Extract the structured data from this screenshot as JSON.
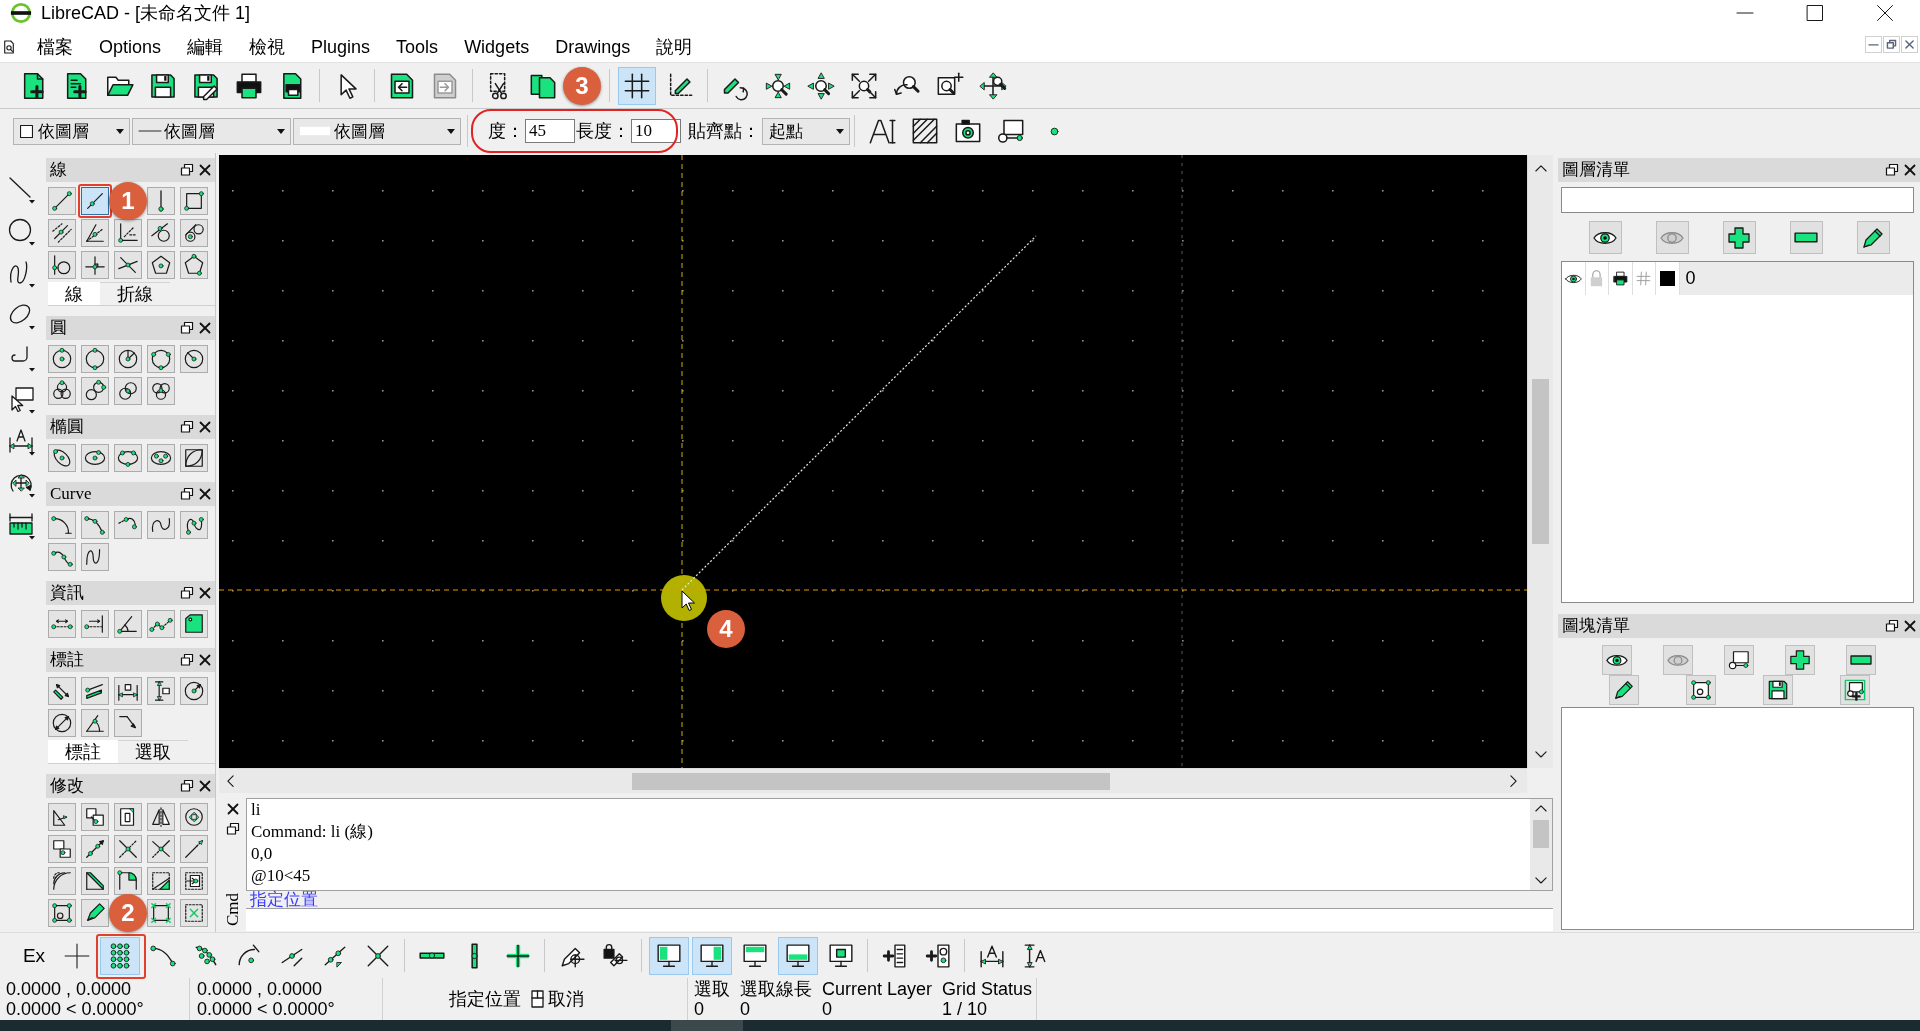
{
  "window": {
    "title": "LibreCAD - [未命名文件 1]"
  },
  "menu_bar": {
    "items": [
      "檔案",
      "Options",
      "編輯",
      "檢視",
      "Plugins",
      "Tools",
      "Widgets",
      "Drawings",
      "說明"
    ]
  },
  "main_toolbar": {
    "groups": [
      {
        "buttons": [
          {
            "kind": "new"
          },
          {
            "kind": "template"
          },
          {
            "kind": "open"
          },
          {
            "kind": "save"
          },
          {
            "kind": "saveas"
          },
          {
            "kind": "print"
          },
          {
            "kind": "preview"
          }
        ]
      },
      {
        "buttons": [
          {
            "kind": "select"
          }
        ]
      },
      {
        "buttons": [
          {
            "kind": "undo"
          },
          {
            "kind": "redo"
          }
        ]
      },
      {
        "buttons": [
          {
            "kind": "cut"
          },
          {
            "kind": "copy"
          },
          {
            "kind": "callout",
            "label": "3"
          }
        ]
      },
      {
        "buttons": [
          {
            "kind": "grid",
            "selected": true
          },
          {
            "kind": "draft",
            "selected": false
          }
        ]
      },
      {
        "buttons": [
          {
            "kind": "redraw"
          },
          {
            "kind": "zoomin"
          },
          {
            "kind": "zoomout"
          },
          {
            "kind": "zoomauto"
          },
          {
            "kind": "zoomprev"
          },
          {
            "kind": "zoomwin"
          },
          {
            "kind": "zoompan"
          }
        ]
      }
    ]
  },
  "property_bar": {
    "combos": [
      {
        "kind": "color",
        "value": "依圖層"
      },
      {
        "kind": "linetype",
        "value": "依圖層"
      },
      {
        "kind": "width",
        "value": "依圖層"
      }
    ]
  },
  "line_options": {
    "angle_label": "度：",
    "angle": "45",
    "length_label": "長度：",
    "length": "10",
    "snap_label": "貼齊點：",
    "snap_point": "起點"
  },
  "insert_toolbar": {
    "buttons": [
      {
        "kind": "text"
      },
      {
        "kind": "hatch"
      },
      {
        "kind": "image"
      },
      {
        "kind": "block"
      },
      {
        "kind": "point"
      }
    ]
  },
  "tool_strip": {
    "buttons": [
      {
        "kind": "tline"
      },
      {
        "kind": "tcircle"
      },
      {
        "kind": "tspline"
      },
      {
        "kind": "tellipse"
      },
      {
        "kind": "tpolyline"
      },
      {
        "kind": "tselect"
      },
      {
        "kind": "tdim"
      },
      {
        "kind": "tmodify"
      },
      {
        "kind": "tinfo"
      }
    ]
  },
  "toolbox": [
    {
      "title": "線",
      "buttons": [
        {
          "kind": "line2p",
          "selected": false
        },
        {
          "kind": "lineangle",
          "selected": true
        },
        {
          "kind": "callout",
          "label": "1"
        },
        {
          "kind": "linever",
          "selected": false
        },
        {
          "kind": "rect",
          "selected": false
        },
        {
          "kind": "parallel",
          "selected": false
        },
        {
          "kind": "bisector",
          "selected": false
        },
        {
          "kind": "axes",
          "selected": false
        },
        {
          "kind": "tangent",
          "selected": false
        },
        {
          "kind": "tancircles",
          "selected": false
        },
        {
          "kind": "circleline",
          "selected": false
        },
        {
          "kind": "perpendicular",
          "selected": false
        },
        {
          "kind": "crossing",
          "selected": false
        },
        {
          "kind": "polycenter",
          "selected": false
        },
        {
          "kind": "polycorner",
          "selected": false
        }
      ],
      "tabs": [
        {
          "label": "線",
          "selected": true
        },
        {
          "label": "折線",
          "selected": false
        }
      ]
    },
    {
      "title": "圓",
      "buttons": [
        {
          "kind": "circcenter"
        },
        {
          "kind": "circ2p"
        },
        {
          "kind": "circsector"
        },
        {
          "kind": "circ3p"
        },
        {
          "kind": "circradius"
        },
        {
          "kind": "circles"
        },
        {
          "kind": "twocircles"
        },
        {
          "kind": "overlapcircles"
        },
        {
          "kind": "circlecluster"
        }
      ]
    },
    {
      "title": "橢圓",
      "buttons": [
        {
          "kind": "ellipse"
        },
        {
          "kind": "ellcenter"
        },
        {
          "kind": "ellpoints"
        },
        {
          "kind": "ellfoci"
        },
        {
          "kind": "ellinscribed"
        }
      ]
    },
    {
      "title": "Curve",
      "buttons": [
        {
          "kind": "arc"
        },
        {
          "kind": "arcpoints"
        },
        {
          "kind": "arctangent"
        },
        {
          "kind": "loop"
        },
        {
          "kind": "looppoints"
        },
        {
          "kind": "curvepoints"
        },
        {
          "kind": "wave"
        }
      ]
    },
    {
      "title": "資訊",
      "buttons": [
        {
          "kind": "distpoint"
        },
        {
          "kind": "distline"
        },
        {
          "kind": "angle"
        },
        {
          "kind": "polylen"
        },
        {
          "kind": "area"
        }
      ]
    },
    {
      "title": "標註",
      "buttons": [
        {
          "kind": "dimaligned"
        },
        {
          "kind": "dimslant"
        },
        {
          "kind": "dimhor"
        },
        {
          "kind": "dimver"
        },
        {
          "kind": "dimradius"
        },
        {
          "kind": "dimdiameter"
        },
        {
          "kind": "dimangular"
        },
        {
          "kind": "leader"
        }
      ],
      "tabs": [
        {
          "label": "標註",
          "selected": true
        },
        {
          "label": "選取",
          "selected": false
        }
      ]
    },
    {
      "title": "修改",
      "buttons": [
        {
          "kind": "move"
        },
        {
          "kind": "duplicate"
        },
        {
          "kind": "scale"
        },
        {
          "kind": "mirror"
        },
        {
          "kind": "rotate"
        },
        {
          "kind": "moverotate"
        },
        {
          "kind": "stretch"
        },
        {
          "kind": "trim"
        },
        {
          "kind": "trim2"
        },
        {
          "kind": "lengthen"
        },
        {
          "kind": "offset"
        },
        {
          "kind": "bevel"
        },
        {
          "kind": "fillet"
        },
        {
          "kind": "divide"
        },
        {
          "kind": "explode"
        },
        {
          "kind": "properties"
        },
        {
          "kind": "attributes"
        },
        {
          "kind": "callout",
          "label": "2"
        },
        {
          "kind": "corners"
        },
        {
          "kind": "deleteframe"
        }
      ]
    }
  ],
  "command_line": {
    "label": "Cmd",
    "history": [
      "li",
      "Command: li (線)",
      "0,0",
      "@10<45"
    ],
    "prompt": "指定位置"
  },
  "layer_list": {
    "title": "圖層清單",
    "buttons": [
      {
        "kind": "showall"
      },
      {
        "kind": "hideall"
      },
      {
        "kind": "add"
      },
      {
        "kind": "remove"
      },
      {
        "kind": "edit"
      }
    ],
    "layers": [
      {
        "name": "0",
        "selected": true,
        "visible": true,
        "locked": false,
        "printable": true,
        "construction": false,
        "color": "#000000"
      }
    ]
  },
  "block_list": {
    "title": "圖塊清單",
    "buttons": [
      {
        "kind": "showall"
      },
      {
        "kind": "hideall"
      },
      {
        "kind": "blockcreate"
      },
      {
        "kind": "add"
      },
      {
        "kind": "remove"
      },
      {
        "kind": "edit"
      },
      {
        "kind": "blockedit"
      },
      {
        "kind": "blocksave"
      },
      {
        "kind": "blockinsert"
      }
    ]
  },
  "snap_toolbar": {
    "label": "Ex",
    "groups": [
      {
        "buttons": [
          {
            "kind": "free",
            "selected": false
          },
          {
            "kind": "snapgrid",
            "selected": true
          },
          {
            "kind": "endpoint",
            "selected": false
          },
          {
            "kind": "onentity",
            "selected": false
          },
          {
            "kind": "center",
            "selected": false
          },
          {
            "kind": "middle",
            "selected": false
          },
          {
            "kind": "distance",
            "selected": false
          },
          {
            "kind": "intersection",
            "selected": false
          }
        ]
      },
      {
        "buttons": [
          {
            "kind": "horizontal"
          },
          {
            "kind": "vertical"
          },
          {
            "kind": "ortho"
          }
        ]
      },
      {
        "buttons": [
          {
            "kind": "relzero"
          },
          {
            "kind": "lockzero"
          }
        ]
      },
      {
        "buttons": [
          {
            "kind": "leftdock",
            "selected": true
          },
          {
            "kind": "rightdock",
            "selected": true
          },
          {
            "kind": "topdock",
            "selected": false
          },
          {
            "kind": "bottomdock",
            "selected": true
          },
          {
            "kind": "floating",
            "selected": false
          }
        ]
      },
      {
        "buttons": [
          {
            "kind": "addlist"
          },
          {
            "kind": "addblock"
          }
        ]
      },
      {
        "buttons": [
          {
            "kind": "dimhtext"
          },
          {
            "kind": "dimvtext"
          }
        ]
      }
    ]
  },
  "status_bar": {
    "absolute": [
      "0.0000 , 0.0000",
      "0.0000 < 0.0000°"
    ],
    "relative": [
      "0.0000 , 0.0000",
      "0.0000 < 0.0000°"
    ],
    "mouse": {
      "left": "指定位置",
      "right": "取消"
    },
    "fields": [
      {
        "label": "選取",
        "value": "0"
      },
      {
        "label": "選取線長",
        "value": "0"
      },
      {
        "label": "Current Layer",
        "value": "0"
      },
      {
        "label": "Grid Status",
        "value": "1 / 10"
      }
    ]
  },
  "annotations": {
    "frames": [
      {
        "kind": "square"
      },
      {
        "kind": "square"
      },
      {
        "kind": "oval"
      }
    ],
    "callouts": [
      {
        "label": "4"
      }
    ]
  }
}
